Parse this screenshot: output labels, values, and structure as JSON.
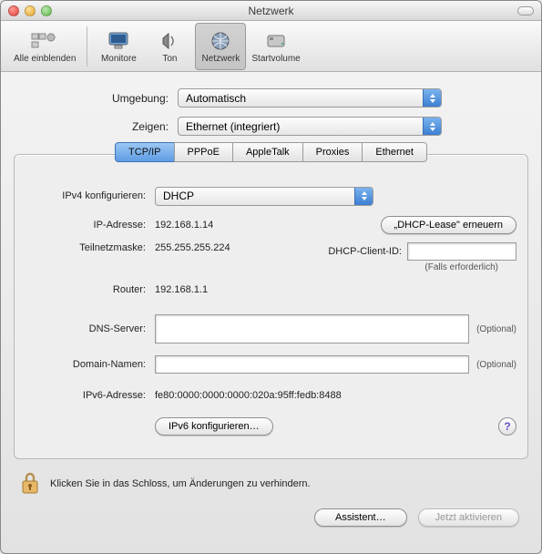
{
  "window": {
    "title": "Netzwerk"
  },
  "toolbar": {
    "show_all": "Alle einblenden",
    "displays": "Monitore",
    "sound": "Ton",
    "network": "Netzwerk",
    "startup": "Startvolume"
  },
  "dropdowns": {
    "location_label": "Umgebung:",
    "location_value": "Automatisch",
    "show_label": "Zeigen:",
    "show_value": "Ethernet (integriert)"
  },
  "tabs": {
    "tcpip": "TCP/IP",
    "pppoe": "PPPoE",
    "appletalk": "AppleTalk",
    "proxies": "Proxies",
    "ethernet": "Ethernet"
  },
  "tcpip": {
    "configure_label": "IPv4 konfigurieren:",
    "configure_value": "DHCP",
    "ip_label": "IP-Adresse:",
    "ip_value": "192.168.1.14",
    "renew_button": "„DHCP-Lease\" erneuern",
    "subnet_label": "Teilnetzmaske:",
    "subnet_value": "255.255.255.224",
    "client_id_label": "DHCP-Client-ID:",
    "client_id_value": "",
    "client_id_hint": "(Falls erforderlich)",
    "router_label": "Router:",
    "router_value": "192.168.1.1",
    "dns_label": "DNS-Server:",
    "dns_value": "",
    "dns_hint": "(Optional)",
    "domain_label": "Domain-Namen:",
    "domain_value": "",
    "domain_hint": "(Optional)",
    "ipv6_label": "IPv6-Adresse:",
    "ipv6_value": "fe80:0000:0000:0000:020a:95ff:fedb:8488",
    "ipv6_button": "IPv6 konfigurieren…"
  },
  "lock": {
    "text": "Klicken Sie in das Schloss, um Änderungen zu verhindern."
  },
  "footer": {
    "assist": "Assistent…",
    "apply": "Jetzt aktivieren"
  }
}
